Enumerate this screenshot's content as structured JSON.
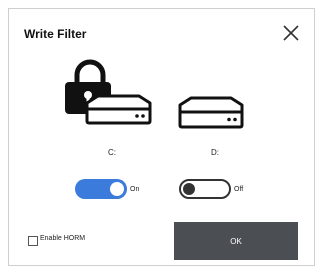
{
  "dialog": {
    "title": "Write Filter",
    "ok_label": "OK",
    "checkbox_label": "Enable HORM",
    "checkbox_checked": false
  },
  "drives": [
    {
      "label": "C:",
      "locked": true,
      "write_filter": "On"
    },
    {
      "label": "D:",
      "locked": false,
      "write_filter": "Off"
    }
  ],
  "colors": {
    "toggle_on": "#3a7bdc",
    "ok_button": "#4b4f54"
  },
  "icons": [
    "close-icon",
    "lock-icon",
    "hard-drive-icon"
  ]
}
